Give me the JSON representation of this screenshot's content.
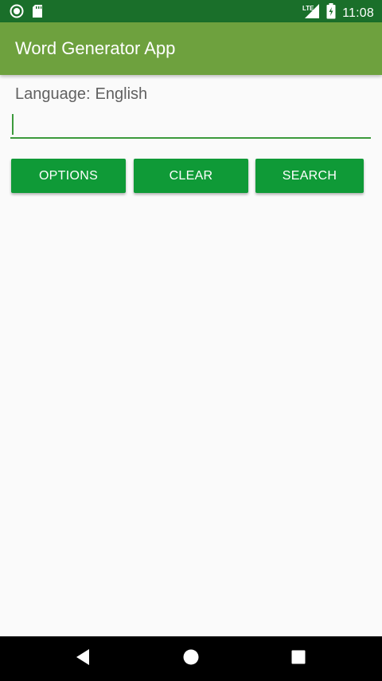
{
  "status_bar": {
    "time": "11:08",
    "network_label": "LTE",
    "icons": [
      "notification-circle-icon",
      "sd-card-icon",
      "lte-signal-icon",
      "battery-charging-icon"
    ]
  },
  "app_bar": {
    "title": "Word Generator App"
  },
  "language": {
    "label": "Language:",
    "value": "English"
  },
  "search_input": {
    "value": "",
    "placeholder": ""
  },
  "buttons": {
    "options": "OPTIONS",
    "clear": "CLEAR",
    "search": "SEARCH"
  },
  "nav_bar": {
    "icons": [
      "back-icon",
      "home-icon",
      "recents-icon"
    ]
  },
  "colors": {
    "status_bar": "#1a6f2a",
    "app_bar": "#6ea13e",
    "button": "#0f9a37",
    "accent": "#3c9a3c",
    "background": "#fafafa"
  }
}
